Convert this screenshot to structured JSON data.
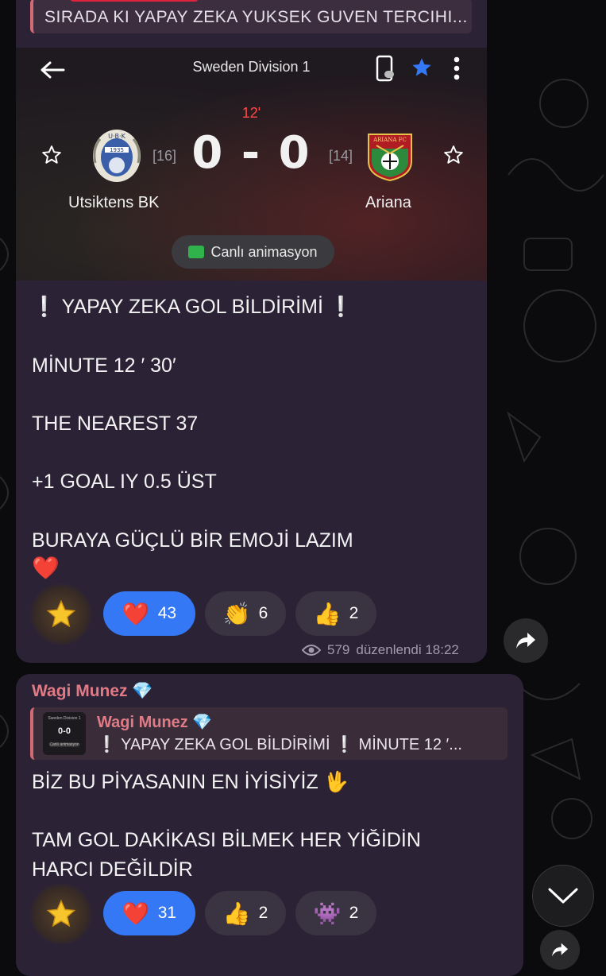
{
  "reply_preview": {
    "text": "SIRADA KI YAPAY ZEKA YUKSEK GUVEN TERCIHI..."
  },
  "match_card": {
    "league": "Sweden Division 1",
    "minute": "12'",
    "home": {
      "name": "Utsiktens BK",
      "rank": "[16]",
      "badge_text_top": "U·B·K",
      "badge_year": "1935"
    },
    "away": {
      "name": "Ariana",
      "rank": "[14]",
      "badge_text_top": "ARIANA FC"
    },
    "score": "0 - 0",
    "live_button": "Canlı animasyon",
    "icons": [
      "back-arrow-icon",
      "phone-toggle-icon",
      "star-filled-icon",
      "more-vert-icon",
      "star-outline-icon"
    ],
    "accent_blue": "#3478f6",
    "minute_color": "#ff4949"
  },
  "message1": {
    "lines": [
      "❕ YAPAY ZEKA GOL BİLDİRİMİ ❕",
      "MİNUTE 12 ′ 30′",
      "THE NEAREST 37",
      "+1 GOAL  IY 0.5  ÜST",
      "BURAYA GÜÇLÜ BİR EMOJİ LAZIM"
    ],
    "heart_line": "❤️",
    "reactions": [
      {
        "emoji": "❤️",
        "count": "43",
        "active": true
      },
      {
        "emoji": "👏",
        "count": "6",
        "active": false
      },
      {
        "emoji": "👍",
        "count": "2",
        "active": false
      }
    ],
    "views": "579",
    "edited_time": "düzenlendi 18:22"
  },
  "message2": {
    "sender": "Wagi Munez 💎",
    "quote": {
      "name": "Wagi Munez 💎",
      "text": "❕ YAPAY ZEKA GOL BİLDİRİMİ ❕  MİNUTE 12 ′...",
      "thumb_score": "0-0",
      "thumb_league": "Sweden Division 1",
      "thumb_live": "Canlı animasyon"
    },
    "lines": [
      "BİZ BU PİYASANIN EN İYİSİYİZ 🖖",
      "TAM GOL DAKİKASI BİLMEK HER YİĞİDİN",
      "HARCI DEĞİLDİR"
    ],
    "reactions": [
      {
        "emoji": "❤️",
        "count": "31",
        "active": true
      },
      {
        "emoji": "👍",
        "count": "2",
        "active": false
      },
      {
        "emoji": "👾",
        "count": "2",
        "active": false
      }
    ]
  }
}
